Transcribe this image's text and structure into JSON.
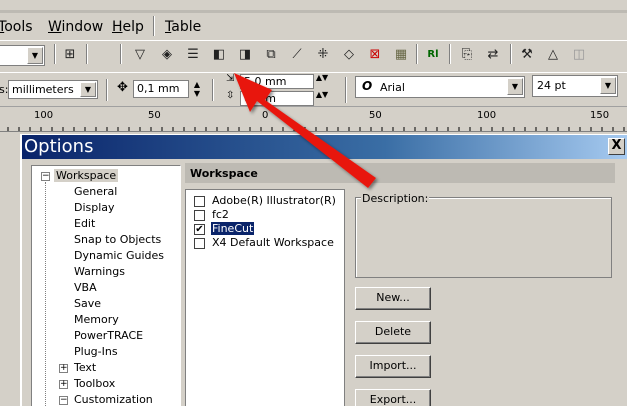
{
  "menubar": {
    "items": [
      "Tools",
      "Window",
      "Help",
      "Table"
    ]
  },
  "toolbar1": {
    "zoom_combo_value": "",
    "icons": [
      "snap-grid-icon",
      "trim-icon",
      "weld-icon",
      "align-icon",
      "back-one-icon",
      "front-one-icon",
      "group-icon",
      "node-icon",
      "combine-icon",
      "intersect-icon",
      "no-fill-icon",
      "hatch-icon",
      "rl-plugin-icon",
      "import-icon",
      "export-icon",
      "hammer-icon",
      "triangle-icon",
      "dim-icon"
    ]
  },
  "toolbar2": {
    "units_label": "s:",
    "units_value": "millimeters",
    "nudge_value": "0,1 mm",
    "dup_x": "5,0 mm",
    "dup_y": "0 mm",
    "font_name": "Arial",
    "font_size": "24 pt"
  },
  "ruler": {
    "labels": [
      "100",
      "50",
      "0",
      "50",
      "100",
      "150"
    ]
  },
  "dialog": {
    "title": "Options",
    "close_label": "X",
    "tree": {
      "root": "Workspace",
      "children": [
        "General",
        "Display",
        "Edit",
        "Snap to Objects",
        "Dynamic Guides",
        "Warnings",
        "VBA",
        "Save",
        "Memory",
        "PowerTRACE",
        "Plug-Ins"
      ],
      "collapsed": [
        "Text",
        "Toolbox"
      ],
      "expanded": [
        "Customization"
      ]
    },
    "panel_title": "Workspace",
    "workspaces": [
      {
        "label": "Adobe(R) Illustrator(R)",
        "checked": false
      },
      {
        "label": "fc2",
        "checked": false
      },
      {
        "label": "FineCut",
        "checked": true
      },
      {
        "label": "X4 Default Workspace",
        "checked": false
      }
    ],
    "description_label": "Description:",
    "buttons": [
      "New...",
      "Delete",
      "Import...",
      "Export..."
    ]
  },
  "colors": {
    "arrow": "#e8180e",
    "title_gradient_start": "#0a246a",
    "selection": "#0a246a"
  }
}
